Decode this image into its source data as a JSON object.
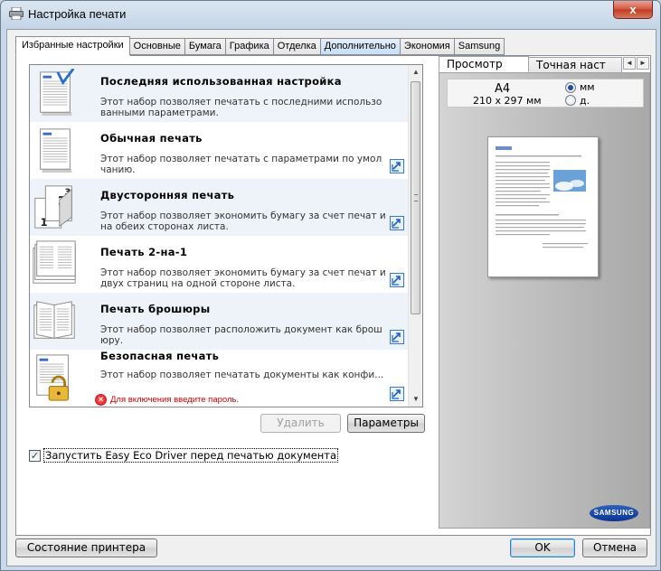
{
  "window": {
    "title": "Настройка печати",
    "close_label": "x"
  },
  "tabs": [
    {
      "label": "Избранные настройки",
      "active": true
    },
    {
      "label": "Основные"
    },
    {
      "label": "Бумага"
    },
    {
      "label": "Графика"
    },
    {
      "label": "Отделка"
    },
    {
      "label": "Дополнительно",
      "highlight": true
    },
    {
      "label": "Экономия"
    },
    {
      "label": "Samsung"
    }
  ],
  "favorites": [
    {
      "name": "Последняя использованная настройка",
      "description": "Этот набор позволяет печатать с последними использо ванными параметрами.",
      "icon": "recent-document-icon",
      "editable": false
    },
    {
      "name": "Обычная печать",
      "description": "Этот набор позволяет печатать с параметрами по умол чанию.",
      "icon": "document-icon",
      "editable": true
    },
    {
      "name": "Двусторонняя печать",
      "description": "Этот набор позволяет экономить бумагу за счет печат и на обеих сторонах листа.",
      "icon": "duplex-icon",
      "editable": true
    },
    {
      "name": "Печать 2-на-1",
      "description": "Этот набор позволяет экономить бумагу за счет печат и двух страниц на одной стороне листа.",
      "icon": "two-up-icon",
      "editable": true
    },
    {
      "name": "Печать брошюры",
      "description": "Этот набор позволяет расположить документ как брош юру.",
      "icon": "booklet-icon",
      "editable": true
    },
    {
      "name": "Безопасная печать",
      "description": "Этот набор позволяет печатать документы как конфи...",
      "icon": "secure-lock-icon",
      "editable": true,
      "warning": "Для включения введите пароль."
    }
  ],
  "buttons": {
    "delete": "Удалить",
    "parameters": "Параметры",
    "printer_status": "Состояние принтера",
    "ok": "OK",
    "cancel": "Отмена"
  },
  "eco_checkbox": {
    "label": "Запустить Easy Eco Driver перед печатью документа",
    "checked": true
  },
  "preview": {
    "tabs": [
      "Просмотр",
      "Точная наст"
    ],
    "paper_name": "A4",
    "paper_dims": "210 x 297 мм",
    "units": [
      {
        "label": "мм",
        "selected": true
      },
      {
        "label": "д.",
        "selected": false
      }
    ],
    "brand": "SAMSUNG"
  },
  "colors": {
    "accent": "#3c7fb1",
    "warning": "#d00000",
    "brand": "#0b3494"
  }
}
